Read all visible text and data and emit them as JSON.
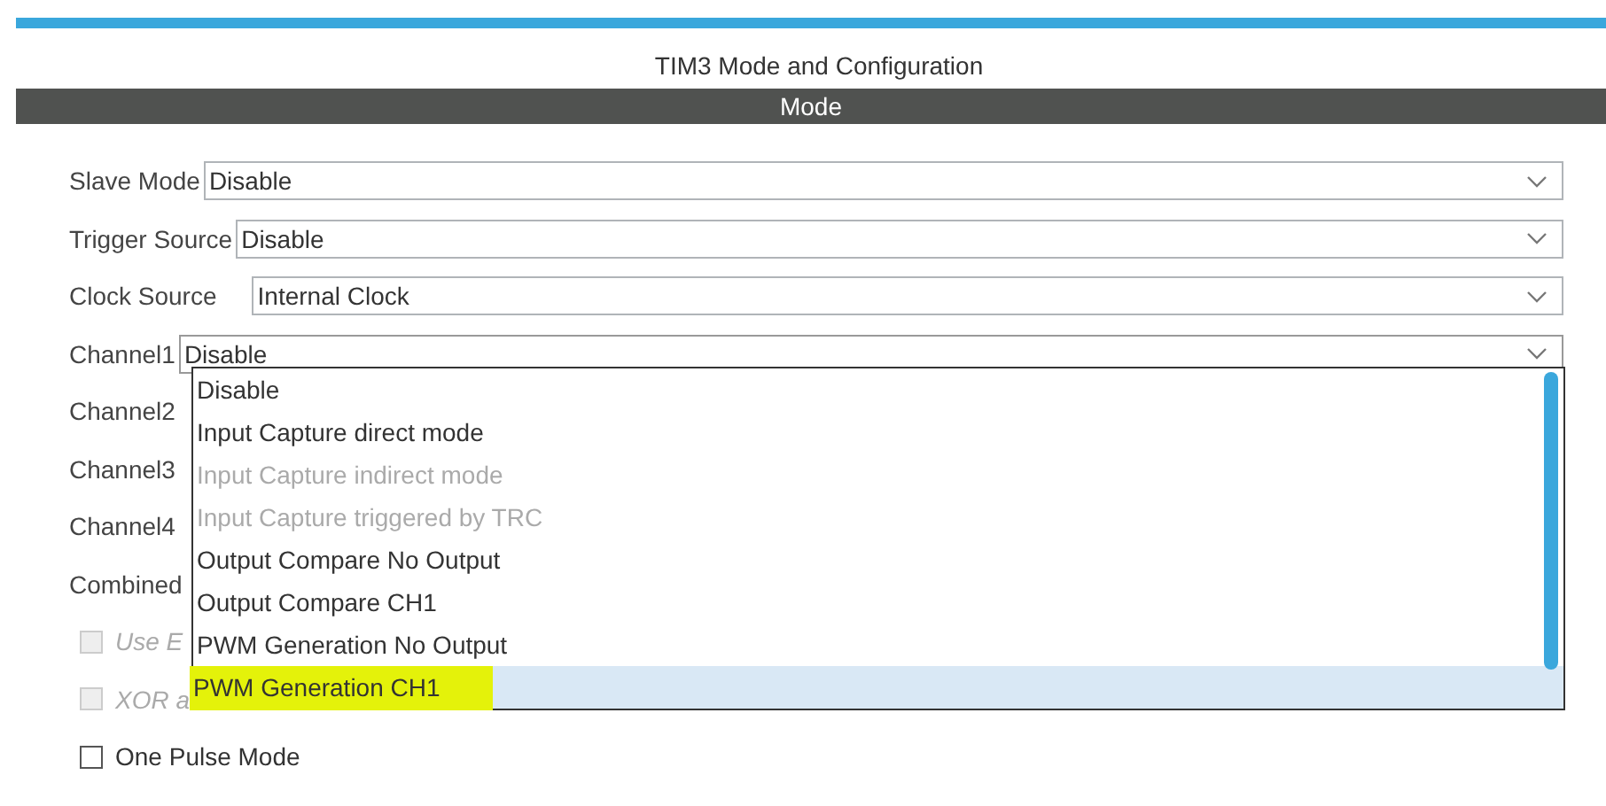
{
  "window": {
    "title": "TIM3 Mode and Configuration"
  },
  "section": {
    "title": "Mode"
  },
  "fields": [
    {
      "label": "Slave Mode",
      "value": "Disable"
    },
    {
      "label": "Trigger Source",
      "value": "Disable"
    },
    {
      "label": "Clock Source",
      "value": "Internal Clock"
    },
    {
      "label": "Channel1",
      "value": "Disable",
      "expanded": true
    }
  ],
  "hidden_labels": [
    "Channel2",
    "Channel3",
    "Channel4",
    "Combined"
  ],
  "checkboxes": [
    {
      "label": "Use E",
      "checked": false,
      "disabled": true
    },
    {
      "label": "XOR a",
      "checked": false,
      "disabled": true
    },
    {
      "label": "One Pulse Mode",
      "checked": false,
      "disabled": false
    }
  ],
  "dropdown": {
    "options": [
      {
        "label": "Disable",
        "disabled": false,
        "selected": false,
        "highlighted": false
      },
      {
        "label": "Input Capture direct mode",
        "disabled": false,
        "selected": false,
        "highlighted": false
      },
      {
        "label": "Input Capture indirect mode",
        "disabled": true,
        "selected": false,
        "highlighted": false
      },
      {
        "label": "Input Capture triggered by TRC",
        "disabled": true,
        "selected": false,
        "highlighted": false
      },
      {
        "label": "Output Compare No Output",
        "disabled": false,
        "selected": false,
        "highlighted": false
      },
      {
        "label": "Output Compare CH1",
        "disabled": false,
        "selected": false,
        "highlighted": false
      },
      {
        "label": "PWM Generation No Output",
        "disabled": false,
        "selected": false,
        "highlighted": false
      },
      {
        "label": "PWM Generation CH1",
        "disabled": false,
        "selected": true,
        "highlighted": true
      }
    ]
  }
}
